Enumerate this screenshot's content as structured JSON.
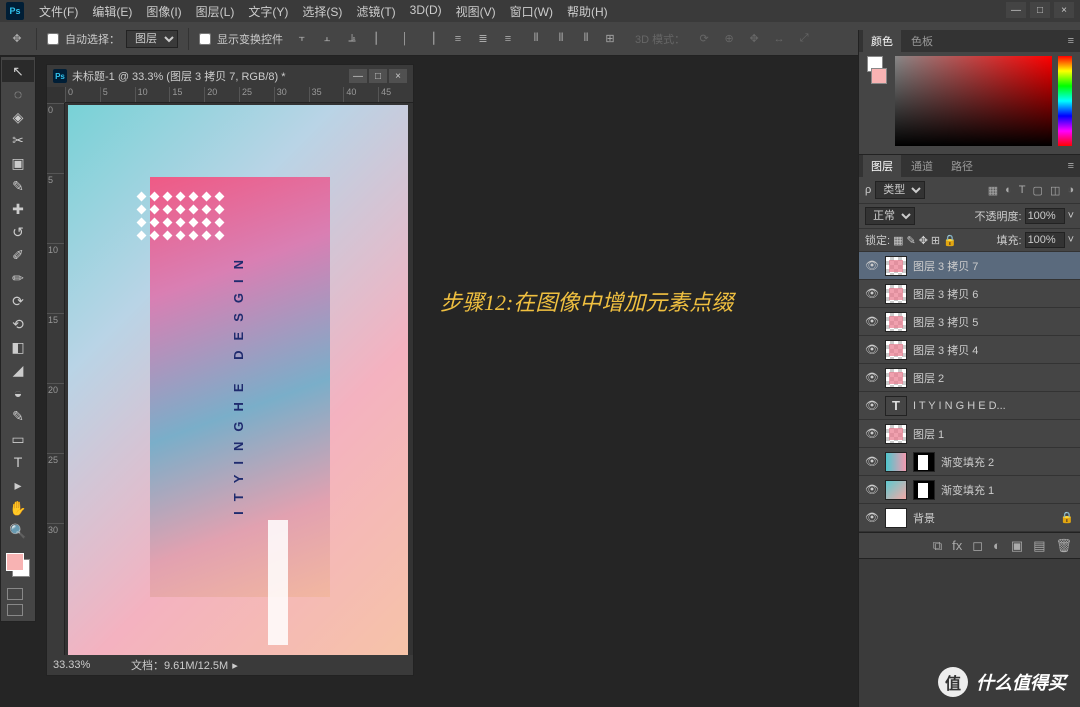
{
  "menu": {
    "items": [
      "文件(F)",
      "编辑(E)",
      "图像(I)",
      "图层(L)",
      "文字(Y)",
      "选择(S)",
      "滤镜(T)",
      "3D(D)",
      "视图(V)",
      "窗口(W)",
      "帮助(H)"
    ]
  },
  "window_controls": {
    "min": "—",
    "max": "□",
    "close": "×"
  },
  "options": {
    "auto_select_label": "自动选择：",
    "auto_select_value": "图层",
    "show_transform_label": "显示变换控件",
    "mode3d_label": "3D 模式："
  },
  "tools": [
    "↖",
    "◌",
    "◈",
    "✂",
    "▣",
    "✎",
    "✚",
    "↺",
    "✐",
    "✏",
    "⟳",
    "⟲",
    "◧",
    "◢",
    "◒",
    "✎",
    "▭",
    "T",
    "▸",
    "✋",
    "🔍"
  ],
  "document": {
    "title": "未标题-1 @ 33.3% (图层 3 拷贝 7, RGB/8) *",
    "ruler_h": [
      "0",
      "5",
      "10",
      "15",
      "20",
      "25",
      "30",
      "35",
      "40",
      "45"
    ],
    "ruler_v": [
      "0",
      "5",
      "10",
      "15",
      "20",
      "25",
      "30"
    ],
    "vtext": "ITYINGHE DESGIN",
    "zoom": "33.33%",
    "docinfo": "文档：9.61M/12.5M"
  },
  "annotation": "步骤12:在图像中增加元素点缀",
  "panels": {
    "color": {
      "tab1": "颜色",
      "tab2": "色板"
    },
    "layers": {
      "tabs": [
        "图层",
        "通道",
        "路径"
      ],
      "kind_label": "类型",
      "blend_label": "正常",
      "opacity_label": "不透明度:",
      "opacity_value": "100%",
      "lock_label": "锁定:",
      "fill_label": "填充:",
      "fill_value": "100%",
      "items": [
        {
          "name": "图层 3 拷贝 7",
          "type": "checker",
          "selected": true
        },
        {
          "name": "图层 3 拷贝 6",
          "type": "checker"
        },
        {
          "name": "图层 3 拷贝 5",
          "type": "checker"
        },
        {
          "name": "图层 3 拷贝 4",
          "type": "checker"
        },
        {
          "name": "图层 2",
          "type": "checker"
        },
        {
          "name": "I T Y I N G H E   D...",
          "type": "text"
        },
        {
          "name": "图层 1",
          "type": "checker"
        },
        {
          "name": "渐变填充 2",
          "type": "grad1",
          "mask": true
        },
        {
          "name": "渐变填充 1",
          "type": "grad2",
          "mask": true
        },
        {
          "name": "背景",
          "type": "white",
          "locked": true
        }
      ]
    }
  },
  "watermark": {
    "badge": "值",
    "text": "什么值得买"
  }
}
